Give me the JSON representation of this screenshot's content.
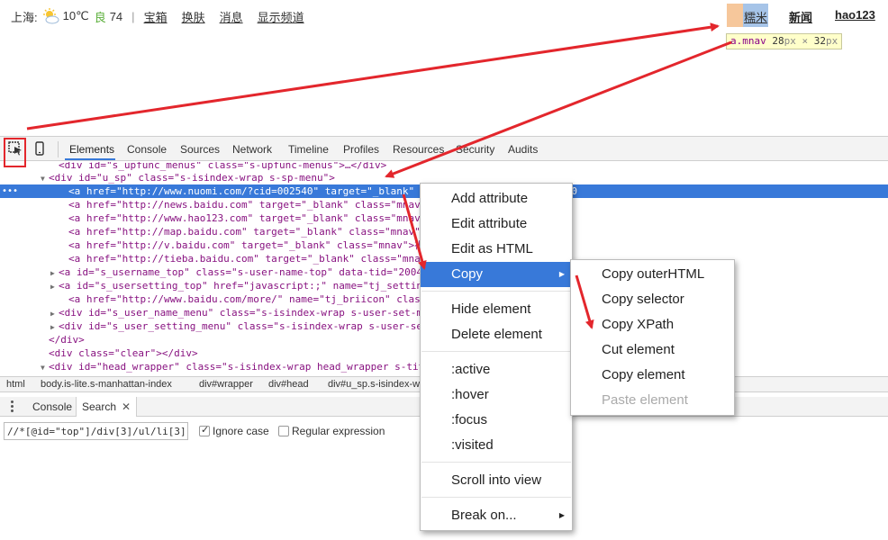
{
  "topbar": {
    "city": "上海:",
    "temp": "10℃",
    "aqi_label": "良",
    "aqi_value": "74",
    "separator": "|",
    "links": [
      "宝箱",
      "换肤",
      "消息",
      "显示频道"
    ],
    "mnav_label": "糯米",
    "nav_news": "新闻",
    "nav_hao123": "hao123",
    "tooltip_selector": "a.mnav",
    "tooltip_w": "28",
    "tooltip_h": "32",
    "tooltip_unit": "px",
    "tooltip_x": "×"
  },
  "devtools": {
    "tabs": [
      "Elements",
      "Console",
      "Sources",
      "Network",
      "Timeline",
      "Profiles",
      "Resources",
      "Security",
      "Audits"
    ],
    "tree": [
      {
        "indent": 5,
        "tri": "",
        "text": "<div id=\"s_upfunc_menus\" class=\"s-upfunc-menus\">…</div>"
      },
      {
        "indent": 4,
        "tri": "▼",
        "text": "<div id=\"u_sp\" class=\"s-isindex-wrap s-sp-menu\">"
      },
      {
        "indent": 6,
        "tri": "",
        "text": "<a href=\"http://www.nuomi.com/?cid=002540\" target=\"_blank\" class=\"mnav\">糯米</a> == $0"
      },
      {
        "indent": 6,
        "tri": "",
        "text": "<a href=\"http://news.baidu.com\" target=\"_blank\" class=\"mnav\">新闻</a>"
      },
      {
        "indent": 6,
        "tri": "",
        "text": "<a href=\"http://www.hao123.com\" target=\"_blank\" class=\"mnav\">hao123</a>"
      },
      {
        "indent": 6,
        "tri": "",
        "text": "<a href=\"http://map.baidu.com\" target=\"_blank\" class=\"mnav\">地图</a>"
      },
      {
        "indent": 6,
        "tri": "",
        "text": "<a href=\"http://v.baidu.com\" target=\"_blank\" class=\"mnav\">视频</a>"
      },
      {
        "indent": 6,
        "tri": "",
        "text": "<a href=\"http://tieba.baidu.com\" target=\"_blank\" class=\"mnav\">贴吧</a>"
      },
      {
        "indent": 5,
        "tri": "▶",
        "text": "<a id=\"s_username_top\" class=\"s-user-name-top\" data-tid=\"2004\">…</a>"
      },
      {
        "indent": 5,
        "tri": "▶",
        "text": "<a id=\"s_usersetting_top\" href=\"javascript:;\" name=\"tj_settingicon\">…</a>"
      },
      {
        "indent": 6,
        "tri": "",
        "text": "<a href=\"http://www.baidu.com/more/\" name=\"tj_briicon\" class=\"s_bri\">…</a>"
      },
      {
        "indent": 5,
        "tri": "▶",
        "text": "<div id=\"s_user_name_menu\" class=\"s-isindex-wrap s-user-set-menu\">…</div>"
      },
      {
        "indent": 5,
        "tri": "▶",
        "text": "<div id=\"s_user_setting_menu\" class=\"s-isindex-wrap s-user-set-menu\">…</div>"
      },
      {
        "indent": 4,
        "tri": "",
        "text": "</div>"
      },
      {
        "indent": 4,
        "tri": "",
        "text": "<div class=\"clear\"></div>"
      },
      {
        "indent": 4,
        "tri": "▼",
        "text": "<div id=\"head_wrapper\" class=\"s-isindex-wrap head_wrapper s-title-img\">"
      }
    ],
    "breadcrumbs": [
      "html",
      "body.is-lite.s-manhattan-index",
      "div#wrapper",
      "div#head",
      "div#u_sp.s-isindex-wrap.s-sp-menu",
      "a.mnav"
    ],
    "drawer_tabs": [
      "Console",
      "Search"
    ],
    "search_value": "//*[@id=\"top\"]/div[3]/ul/li[3]/a",
    "ignore_case": "Ignore case",
    "regex": "Regular expression"
  },
  "context_menu": {
    "items": [
      "Add attribute",
      "Edit attribute",
      "Edit as HTML",
      "Copy",
      "Hide element",
      "Delete element",
      ":active",
      ":hover",
      ":focus",
      ":visited",
      "Scroll into view",
      "Break on..."
    ]
  },
  "copy_submenu": {
    "items": [
      "Copy outerHTML",
      "Copy selector",
      "Copy XPath",
      "Cut element",
      "Copy element",
      "Paste element"
    ]
  },
  "colors": {
    "selection": "#3879d9",
    "annotation": "#e3262c",
    "tag": "#881280",
    "attr_name": "#994500",
    "attr_value": "#1a1aa6"
  }
}
